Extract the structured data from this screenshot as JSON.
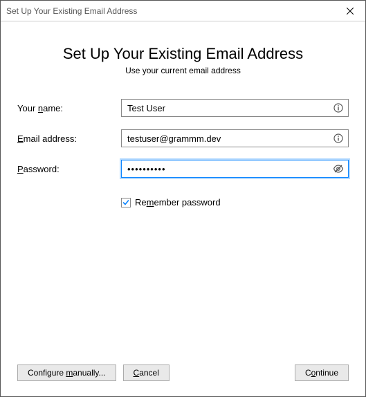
{
  "window": {
    "title": "Set Up Your Existing Email Address"
  },
  "header": {
    "heading": "Set Up Your Existing Email Address",
    "subheading": "Use your current email address"
  },
  "form": {
    "name": {
      "label_pre": "Your ",
      "label_accel": "n",
      "label_post": "ame:",
      "value": "Test User"
    },
    "email": {
      "label_pre": "",
      "label_accel": "E",
      "label_post": "mail address:",
      "value": "testuser@grammm.dev"
    },
    "password": {
      "label_pre": "",
      "label_accel": "P",
      "label_post": "assword:",
      "value": "••••••••••"
    },
    "remember": {
      "label_pre": "Re",
      "label_accel": "m",
      "label_post": "ember password",
      "checked": true
    }
  },
  "footer": {
    "configure_pre": "Configure ",
    "configure_accel": "m",
    "configure_post": "anually...",
    "cancel_pre": "",
    "cancel_accel": "C",
    "cancel_post": "ancel",
    "continue_pre": "C",
    "continue_accel": "o",
    "continue_post": "ntinue"
  }
}
